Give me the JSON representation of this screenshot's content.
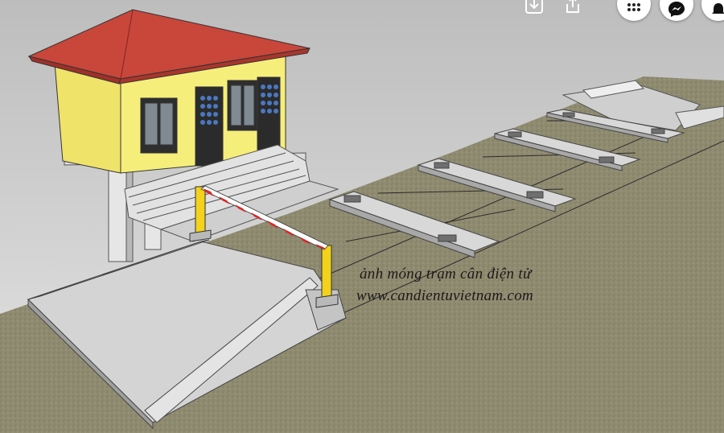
{
  "caption": {
    "line1": "ảnh móng trạm cân điện tử",
    "line2": "www.candientuvietnam.com"
  },
  "overlay_icons": [
    "download-icon",
    "share-icon",
    "apps-grid-icon",
    "messenger-icon",
    "notification-icon"
  ],
  "colors": {
    "sky": "#d9d9d9",
    "ground": "#8e8a6e",
    "roof": "#c9463a",
    "wall": "#f6ee7a",
    "concrete": "#d4d4d4",
    "barrier_red": "#d62a2a",
    "post_yellow": "#f2d21b"
  }
}
